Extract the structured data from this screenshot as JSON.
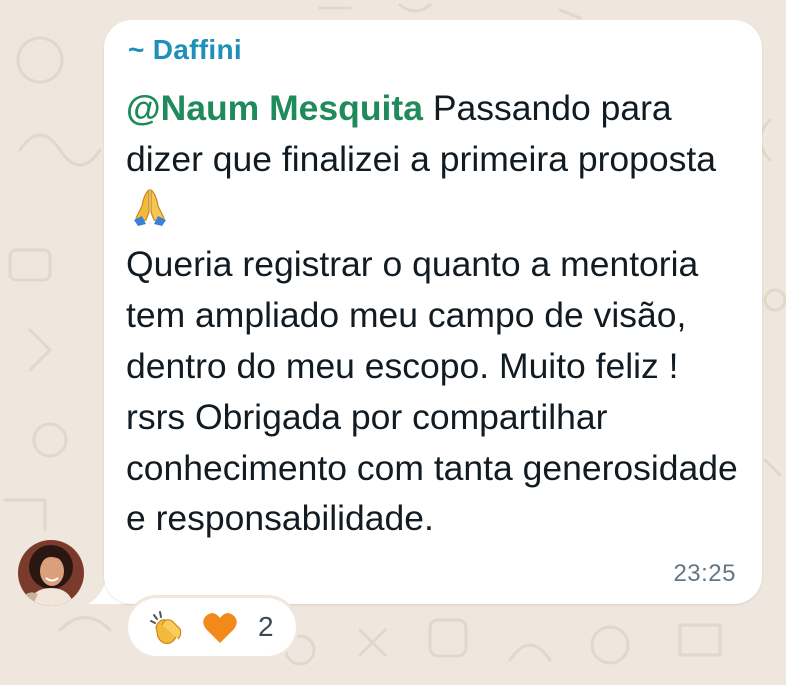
{
  "message": {
    "sender": "~ Daffini",
    "mention": "@Naum Mesquita",
    "text_first": " Passando para dizer que finalizei a primeira proposta",
    "text_second": "Queria registrar o quanto a mentoria tem ampliado meu campo de visão, dentro do meu escopo. Muito feliz ! rsrs Obrigada por compartilhar conhecimento com tanta generosidade e responsabilidade.",
    "emoji_icon": "folded-hands-icon",
    "timestamp": "23:25"
  },
  "reactions": {
    "icons": [
      "clapping-hands-icon",
      "orange-heart-icon"
    ],
    "count": "2"
  },
  "colors": {
    "sender": "#1d8fb8",
    "mention": "#1f8a5b",
    "bubble": "#ffffff",
    "wallpaper": "#efe7dd",
    "timestamp": "#667781"
  }
}
